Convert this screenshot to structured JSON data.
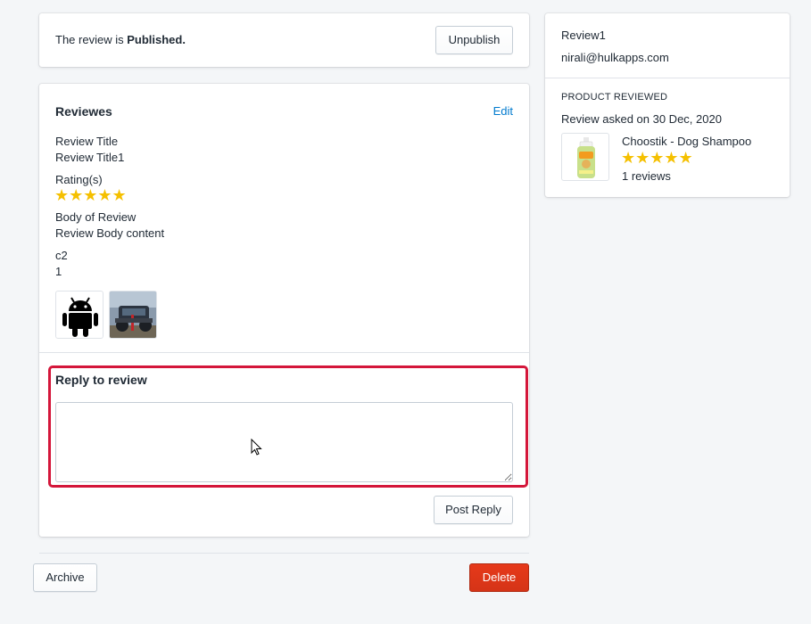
{
  "status_card": {
    "text_prefix": "The review is ",
    "status": "Published.",
    "unpublish_label": "Unpublish"
  },
  "review_card": {
    "heading": "Reviewes",
    "edit_label": "Edit",
    "fields": {
      "title_label": "Review Title",
      "title_value": "Review Title1",
      "rating_label": "Rating(s)",
      "rating_stars": "★★★★★",
      "body_label": "Body of Review",
      "body_value": "Review Body content",
      "custom_label": "c2",
      "custom_value": "1"
    },
    "images": [
      "android-robot-icon",
      "vehicle-photo"
    ]
  },
  "reply": {
    "heading": "Reply to review",
    "textarea_value": "",
    "post_label": "Post Reply",
    "highlight_color": "#d4163a"
  },
  "footer": {
    "archive_label": "Archive",
    "delete_label": "Delete"
  },
  "reviewer": {
    "name": "Review1",
    "email": "nirali@hulkapps.com"
  },
  "product": {
    "section_label": "PRODUCT REVIEWED",
    "asked_on": "Review asked on 30 Dec, 2020",
    "name": "Choostik - Dog Shampoo",
    "stars": "★★★★★",
    "reviews_count": "1 reviews"
  },
  "colors": {
    "star": "#f5c000",
    "link": "#007ace",
    "danger": "#d53417"
  }
}
